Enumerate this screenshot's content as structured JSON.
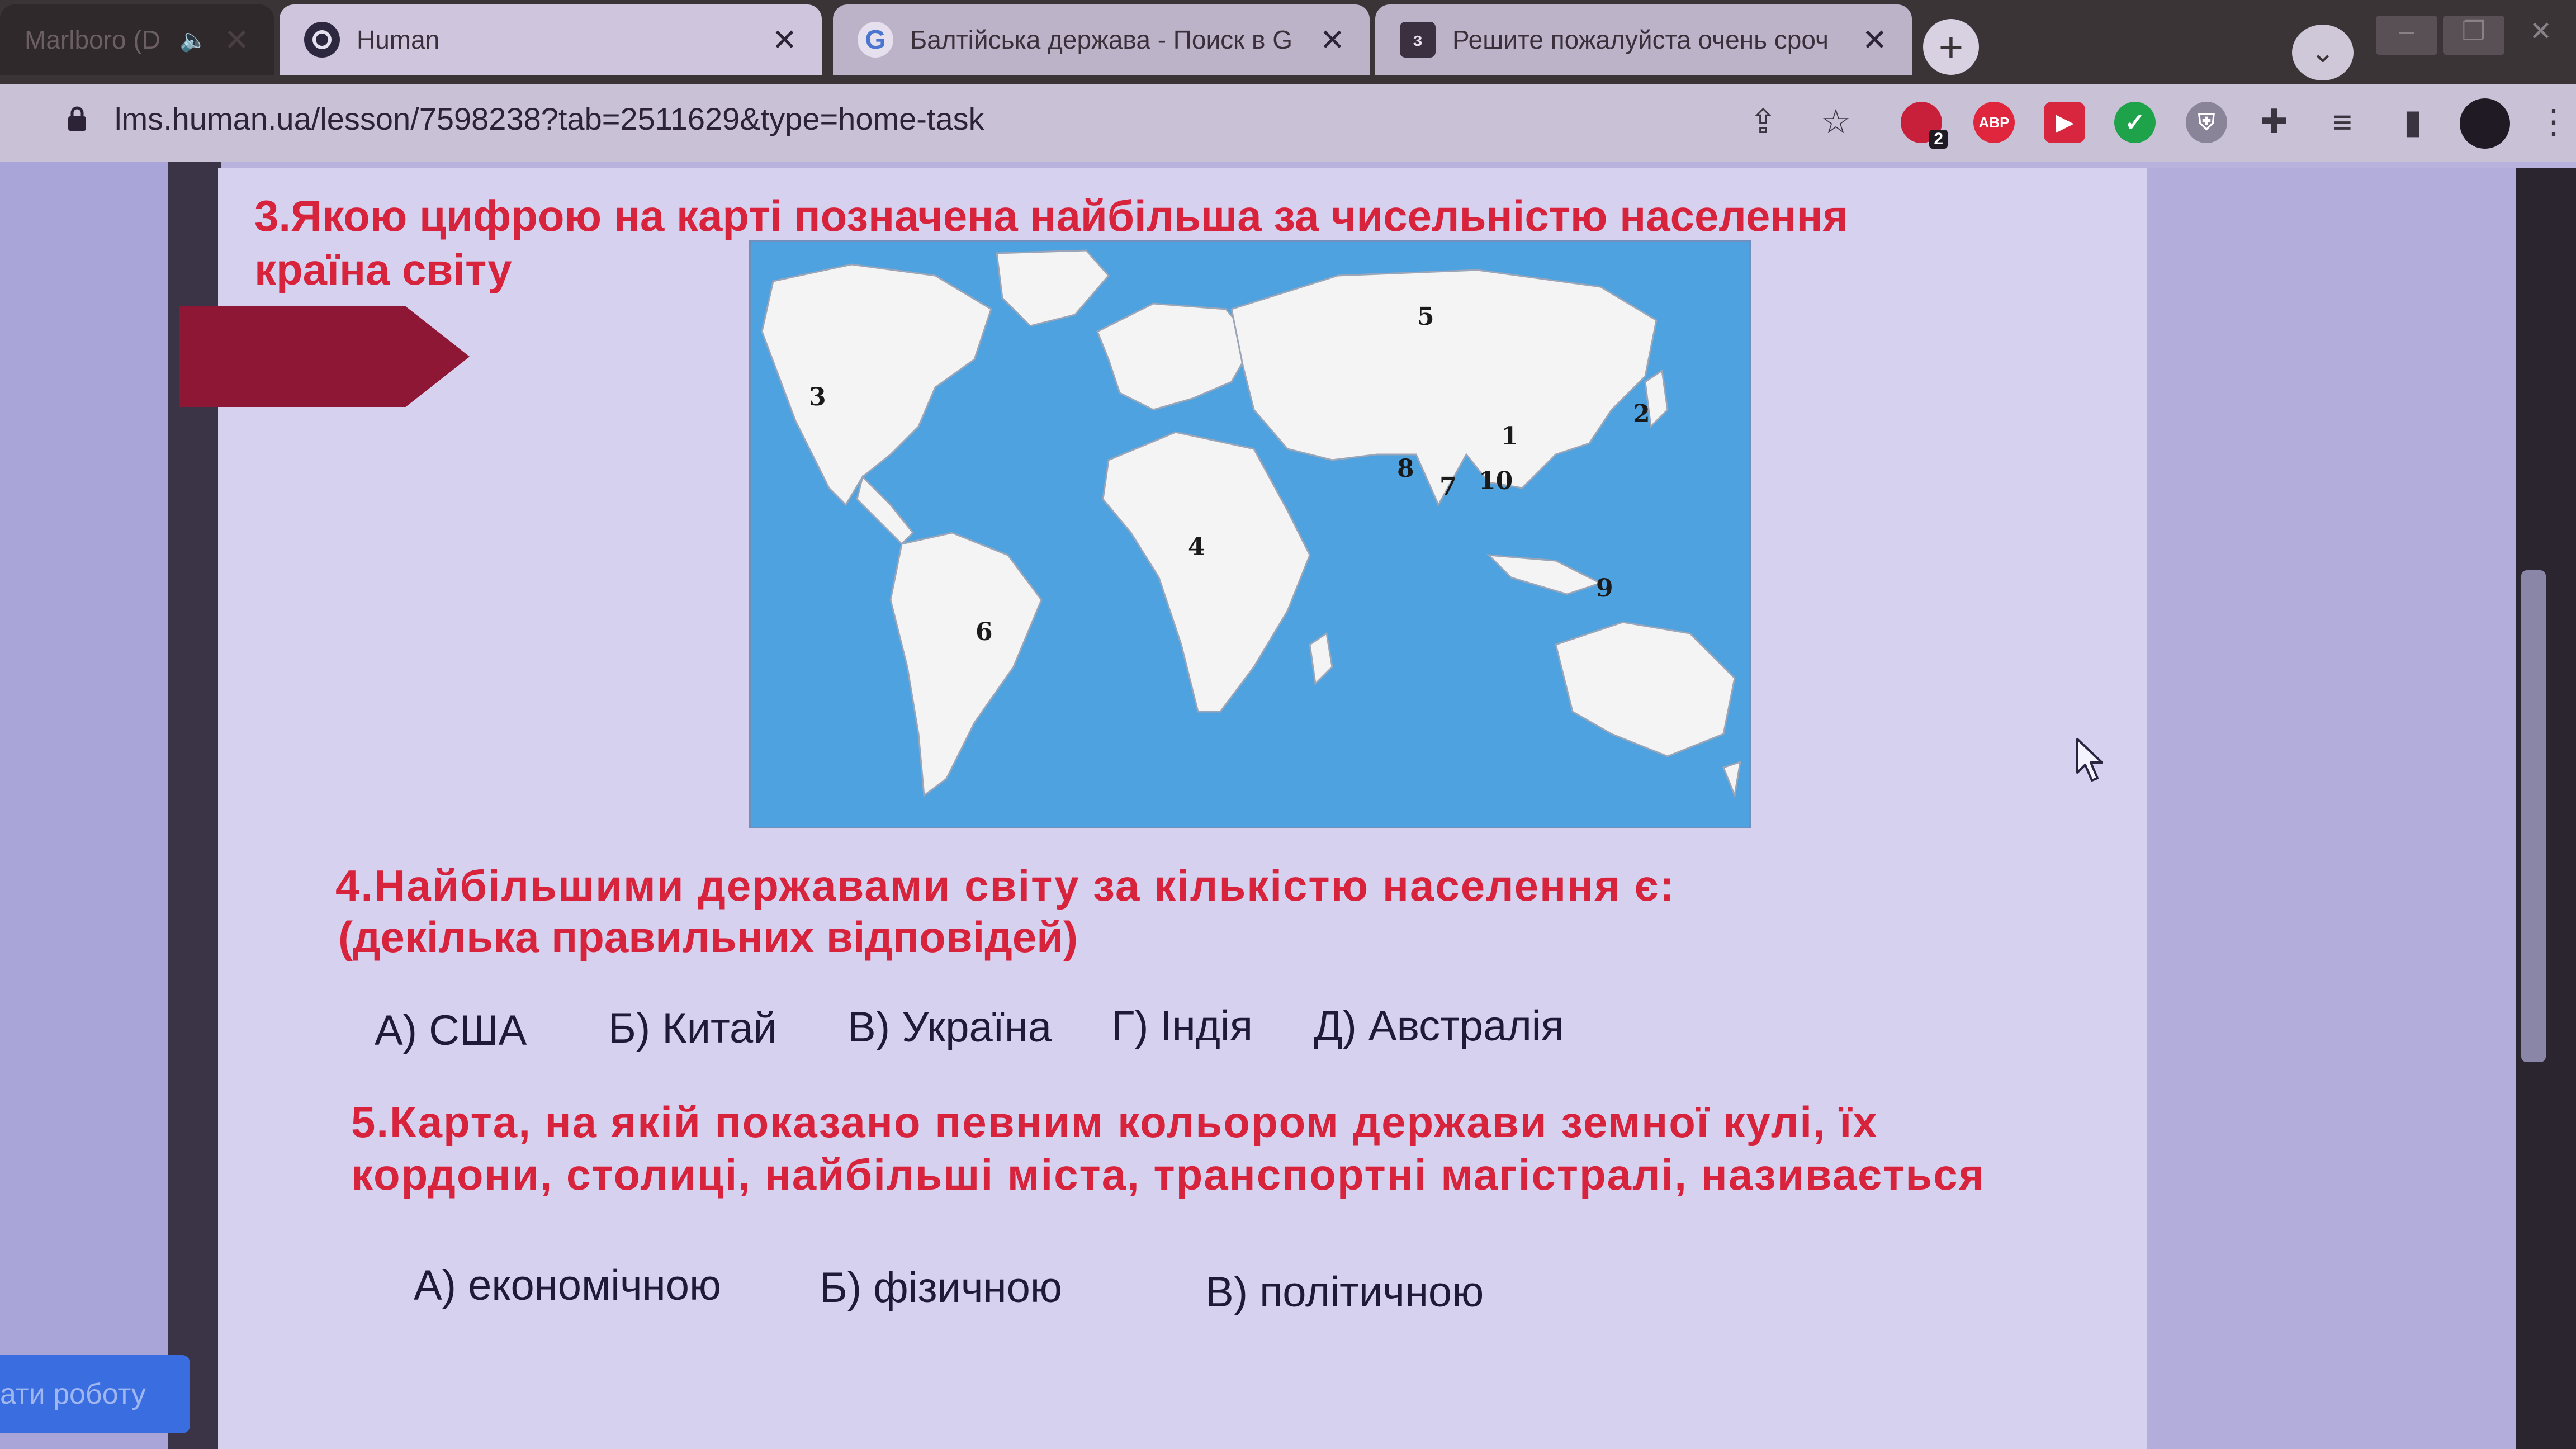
{
  "browser": {
    "tabs": [
      {
        "title": "Marlboro (D",
        "favicon": "speaker-icon"
      },
      {
        "title": "Human",
        "favicon": "human-logo-icon"
      },
      {
        "title": "Балтійська держава - Поиск в G",
        "favicon": "google-icon"
      },
      {
        "title": "Решите пожалуйста очень сроч",
        "favicon": "znanija-icon"
      }
    ],
    "new_tab_label": "+",
    "url": "lms.human.ua/lesson/7598238?tab=2511629&type=home-task",
    "extension_badge": "2",
    "adblock_label": "ABP"
  },
  "questions": {
    "q3": {
      "line1": "3.Якою цифрою на карті позначена найбільша за чисельністю населення",
      "line2": "країна світу"
    },
    "map_labels": [
      "1",
      "2",
      "3",
      "4",
      "5",
      "6",
      "7",
      "8",
      "9",
      "10"
    ],
    "q4": {
      "line1": "4.Найбільшими державами світу за кількістю населення є:",
      "line2": "(декілька правильних відповідей)",
      "options": [
        "А) США",
        "Б)  Китай",
        "В) Україна",
        "Г) Індія",
        "Д) Австралія"
      ]
    },
    "q5": {
      "text": "5.Карта, на якій показано певним кольором держави земної кулі, їх кордони, столиці, найбільші міста, транспортні магістралі, називається",
      "options": [
        "А) економічною",
        "Б) фізичною",
        "В) політичною"
      ]
    }
  },
  "submit_label": "ати роботу",
  "colors": {
    "question": "#d8233c",
    "map_ocean": "#4fa2e0",
    "land": "#f4f4f4"
  }
}
